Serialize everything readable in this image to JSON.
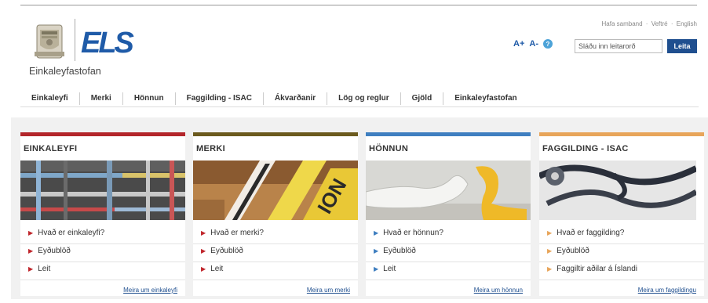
{
  "header": {
    "org_name": "Einkaleyfastofan",
    "logo_text": "ELS",
    "util_links": [
      "Hafa samband",
      "Veftré",
      "English"
    ],
    "util_sep": "·",
    "font_larger": "A+",
    "font_smaller": "A-",
    "help_icon": "?",
    "search_placeholder": "Sláðu inn leitarorð",
    "search_button": "Leita"
  },
  "nav": {
    "items": [
      "Einkaleyfi",
      "Merki",
      "Hönnun",
      "Faggilding - ISAC",
      "Ákvarðanir",
      "Lög og reglur",
      "Gjöld",
      "Einkaleyfastofan"
    ]
  },
  "cards": [
    {
      "title": "EINKALEYFI",
      "accent": "#b3262b",
      "links": [
        "Hvað er einkaleyfi?",
        "Eyðublöð",
        "Leit"
      ],
      "more": "Meira um einkaleyfi"
    },
    {
      "title": "MERKI",
      "accent": "#6b5a1e",
      "links": [
        "Hvað er merki?",
        "Eyðublöð",
        "Leit"
      ],
      "more": "Meira um merki"
    },
    {
      "title": "HÖNNUN",
      "accent": "#3f7fc0",
      "links": [
        "Hvað er hönnun?",
        "Eyðublöð",
        "Leit"
      ],
      "more": "Meira um hönnun"
    },
    {
      "title": "FAGGILDING - ISAC",
      "accent": "#e8a55a",
      "links": [
        "Hvað er faggilding?",
        "Eyðublöð",
        "Faggiltir aðilar á Íslandi"
      ],
      "more": "Meira um faggildingu"
    }
  ],
  "image_texts": {
    "merki_sign": "ION"
  }
}
